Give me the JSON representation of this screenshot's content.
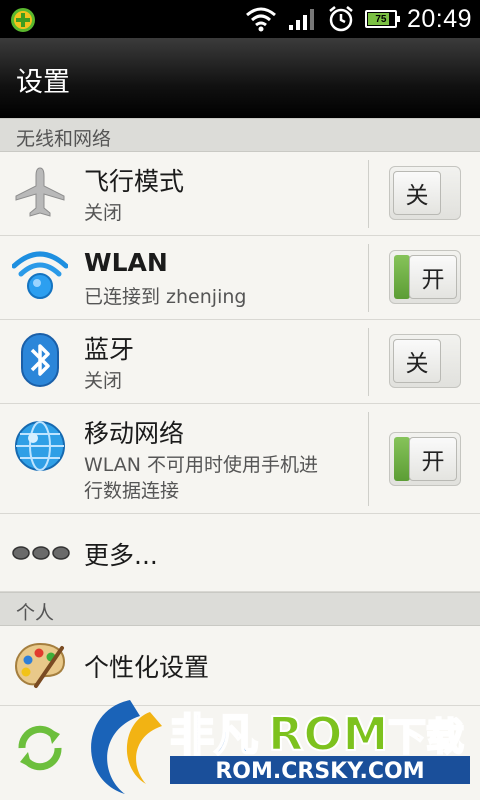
{
  "status_bar": {
    "time": "20:49",
    "battery_level": "75",
    "icons": [
      "app-notification-icon",
      "wifi-icon",
      "signal-icon",
      "alarm-icon",
      "battery-icon"
    ]
  },
  "header": {
    "title": "设置"
  },
  "sections": {
    "wireless": "无线和网络",
    "personal": "个人"
  },
  "rows": {
    "airplane": {
      "title": "飞行模式",
      "subtitle": "关闭",
      "toggle": "关"
    },
    "wlan": {
      "title": "WLAN",
      "subtitle": "已连接到 zhenjing",
      "toggle": "开"
    },
    "bluetooth": {
      "title": "蓝牙",
      "subtitle": "关闭",
      "toggle": "关"
    },
    "mobile": {
      "title": "移动网络",
      "subtitle_line1": "WLAN 不可用时使用手机进",
      "subtitle_line2": "行数据连接",
      "toggle": "开"
    },
    "more": {
      "title": "更多..."
    },
    "personalize": {
      "title": "个性化设置"
    }
  },
  "watermark": {
    "brand_part1": "非凡",
    "brand_part2": "ROM",
    "brand_part3": "下载",
    "url": "ROM.CRSKY.COM"
  },
  "colors": {
    "toggle_on": "#6aad3f",
    "header_bg": "#000000",
    "section_bg": "#dcdcd8"
  }
}
